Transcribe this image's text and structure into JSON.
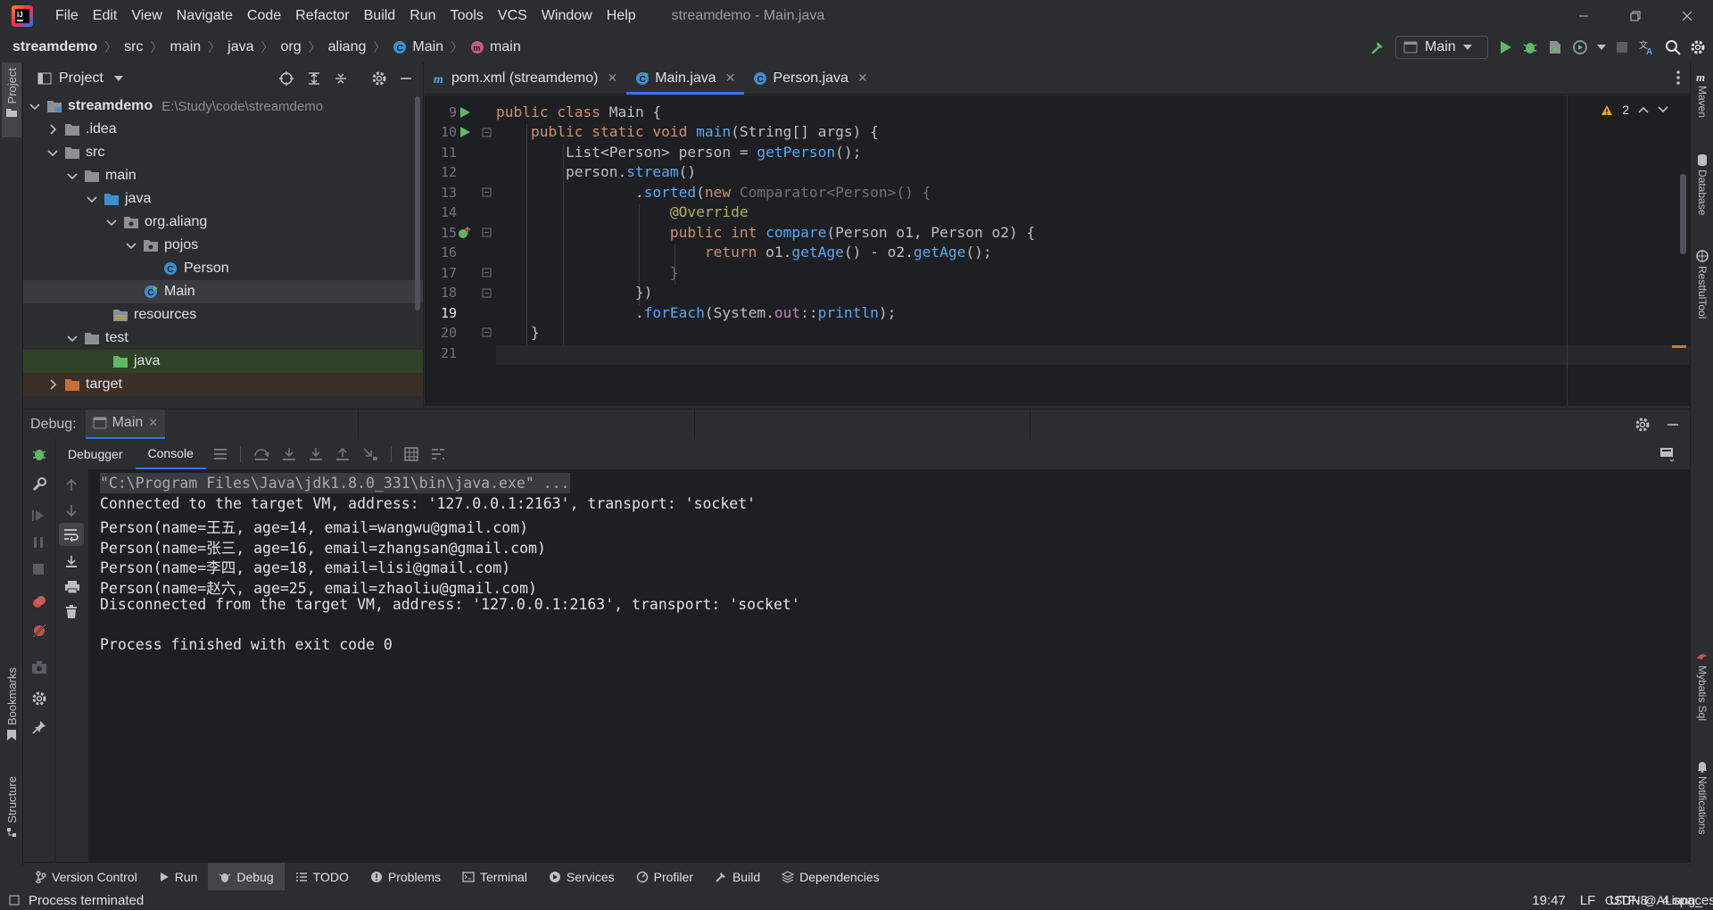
{
  "window": {
    "title": "streamdemo - Main.java",
    "menu": [
      "File",
      "Edit",
      "View",
      "Navigate",
      "Code",
      "Refactor",
      "Build",
      "Run",
      "Tools",
      "VCS",
      "Window",
      "Help"
    ]
  },
  "breadcrumb": [
    "streamdemo",
    "src",
    "main",
    "java",
    "org",
    "aliang",
    "Main",
    "main"
  ],
  "run_config": "Main",
  "left_strip": {
    "project": "Project",
    "bookmarks": "Bookmarks",
    "structure": "Structure"
  },
  "right_strip": {
    "maven": "Maven",
    "database": "Database",
    "restful": "RestfulTool",
    "mybatis": "Mybatis Sql",
    "notifications": "Notifications"
  },
  "project_panel": {
    "title": "Project",
    "tree": [
      {
        "label": "streamdemo",
        "path": "E:\\Study\\code\\streamdemo",
        "depth": 0,
        "expanded": true,
        "type": "module"
      },
      {
        "label": ".idea",
        "depth": 1,
        "expanded": false,
        "type": "folder"
      },
      {
        "label": "src",
        "depth": 1,
        "expanded": true,
        "type": "folder"
      },
      {
        "label": "main",
        "depth": 2,
        "expanded": true,
        "type": "folder"
      },
      {
        "label": "java",
        "depth": 3,
        "expanded": true,
        "type": "source"
      },
      {
        "label": "org.aliang",
        "depth": 4,
        "expanded": true,
        "type": "package"
      },
      {
        "label": "pojos",
        "depth": 5,
        "expanded": true,
        "type": "package"
      },
      {
        "label": "Person",
        "depth": 6,
        "type": "class"
      },
      {
        "label": "Main",
        "depth": 5,
        "type": "class-main",
        "selected": true
      },
      {
        "label": "resources",
        "depth": 3,
        "type": "resources"
      },
      {
        "label": "test",
        "depth": 2,
        "expanded": true,
        "type": "folder"
      },
      {
        "label": "java",
        "depth": 3,
        "type": "test-source"
      },
      {
        "label": "target",
        "depth": 1,
        "expanded": false,
        "type": "excluded"
      }
    ]
  },
  "editor_tabs": [
    {
      "label": "pom.xml (streamdemo)",
      "icon": "maven-icon",
      "active": false
    },
    {
      "label": "Main.java",
      "icon": "class-icon",
      "active": true
    },
    {
      "label": "Person.java",
      "icon": "class-icon",
      "active": false
    }
  ],
  "editor": {
    "warnings": "2",
    "lines": [
      {
        "n": "9"
      },
      {
        "n": "10"
      },
      {
        "n": "11"
      },
      {
        "n": "12"
      },
      {
        "n": "13"
      },
      {
        "n": "14"
      },
      {
        "n": "15"
      },
      {
        "n": "16"
      },
      {
        "n": "17"
      },
      {
        "n": "18"
      },
      {
        "n": "19"
      },
      {
        "n": "20"
      },
      {
        "n": "21"
      }
    ]
  },
  "debug": {
    "label": "Debug:",
    "session": "Main",
    "tabs": [
      "Debugger",
      "Console"
    ],
    "active_tab": "Console",
    "console": [
      "\"C:\\Program Files\\Java\\jdk1.8.0_331\\bin\\java.exe\" ...",
      "Connected to the target VM, address: '127.0.0.1:2163', transport: 'socket'",
      "Person(name=王五, age=14, email=wangwu@gmail.com)",
      "Person(name=张三, age=16, email=zhangsan@gmail.com)",
      "Person(name=李四, age=18, email=lisi@gmail.com)",
      "Person(name=赵六, age=25, email=zhaoliu@gmail.com)",
      "Disconnected from the target VM, address: '127.0.0.1:2163', transport: 'socket'",
      "",
      "Process finished with exit code 0"
    ]
  },
  "tool_windows": [
    "Version Control",
    "Run",
    "Debug",
    "TODO",
    "Problems",
    "Terminal",
    "Services",
    "Profiler",
    "Build",
    "Dependencies"
  ],
  "status": {
    "message": "Process terminated",
    "position": "19:47",
    "line_sep": "LF",
    "encoding": "UTF-8",
    "indent": "4 spaces",
    "watermark": "CSDN @ALiang_"
  },
  "colors": {
    "accent": "#3574f0",
    "bg": "#2b2d30",
    "editor_bg": "#1e1f22",
    "run_green": "#5fb865"
  }
}
